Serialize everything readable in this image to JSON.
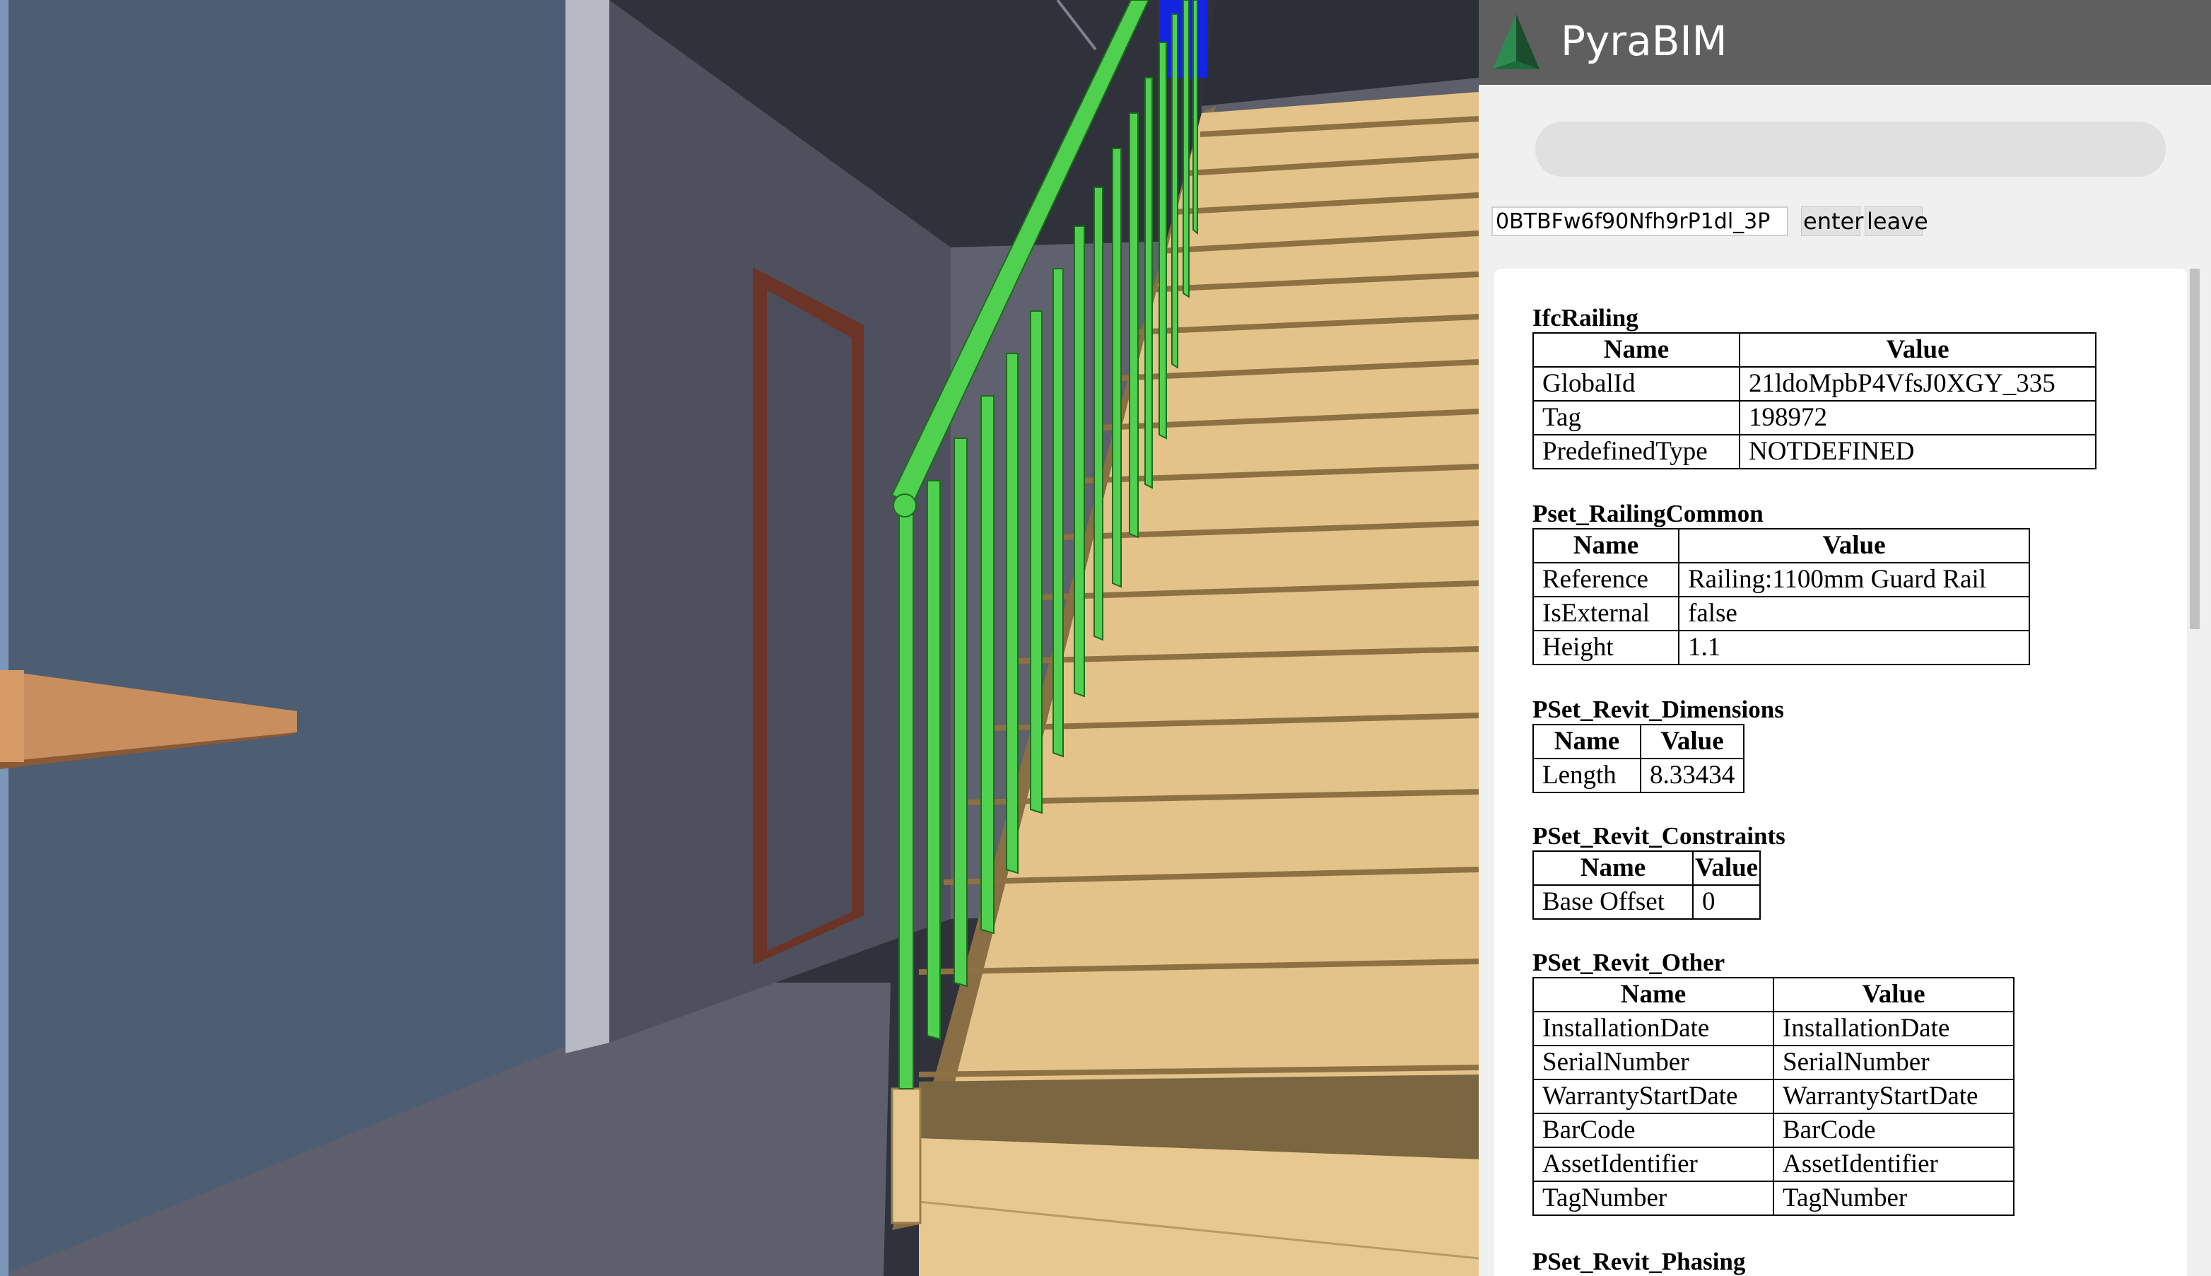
{
  "app": {
    "title": "PyraBIM",
    "logo_colors": [
      "#1e6b3a",
      "#2e8b4f",
      "#1a4d2e"
    ]
  },
  "search": {
    "value": ""
  },
  "navigation": {
    "id_value": "0BTBFw6f90Nfh9rP1dl_3P",
    "enter_label": "enter",
    "leave_label": "leave"
  },
  "viewport": {
    "selected_element_color": "#4fd14f",
    "stair_color": "#e3c38a"
  },
  "properties": {
    "sections": [
      {
        "title": "IfcRailing",
        "headers": [
          "Name",
          "Value"
        ],
        "rows": [
          [
            "GlobalId",
            "21ldoMpbP4VfsJ0XGY_335"
          ],
          [
            "Tag",
            "198972"
          ],
          [
            "PredefinedType",
            "NOTDEFINED"
          ]
        ]
      },
      {
        "title": "Pset_RailingCommon",
        "headers": [
          "Name",
          "Value"
        ],
        "rows": [
          [
            "Reference",
            "Railing:1100mm Guard Rail"
          ],
          [
            "IsExternal",
            "false"
          ],
          [
            "Height",
            "1.1"
          ]
        ]
      },
      {
        "title": "PSet_Revit_Dimensions",
        "headers": [
          "Name",
          "Value"
        ],
        "rows": [
          [
            "Length",
            "8.33434"
          ]
        ]
      },
      {
        "title": "PSet_Revit_Constraints",
        "headers": [
          "Name",
          "Value"
        ],
        "rows": [
          [
            "Base Offset",
            "0"
          ]
        ]
      },
      {
        "title": "PSet_Revit_Other",
        "headers": [
          "Name",
          "Value"
        ],
        "rows": [
          [
            "InstallationDate",
            "InstallationDate"
          ],
          [
            "SerialNumber",
            "SerialNumber"
          ],
          [
            "WarrantyStartDate",
            "WarrantyStartDate"
          ],
          [
            "BarCode",
            "BarCode"
          ],
          [
            "AssetIdentifier",
            "AssetIdentifier"
          ],
          [
            "TagNumber",
            "TagNumber"
          ]
        ]
      },
      {
        "title": "PSet_Revit_Phasing",
        "headers": [],
        "rows": []
      }
    ]
  }
}
